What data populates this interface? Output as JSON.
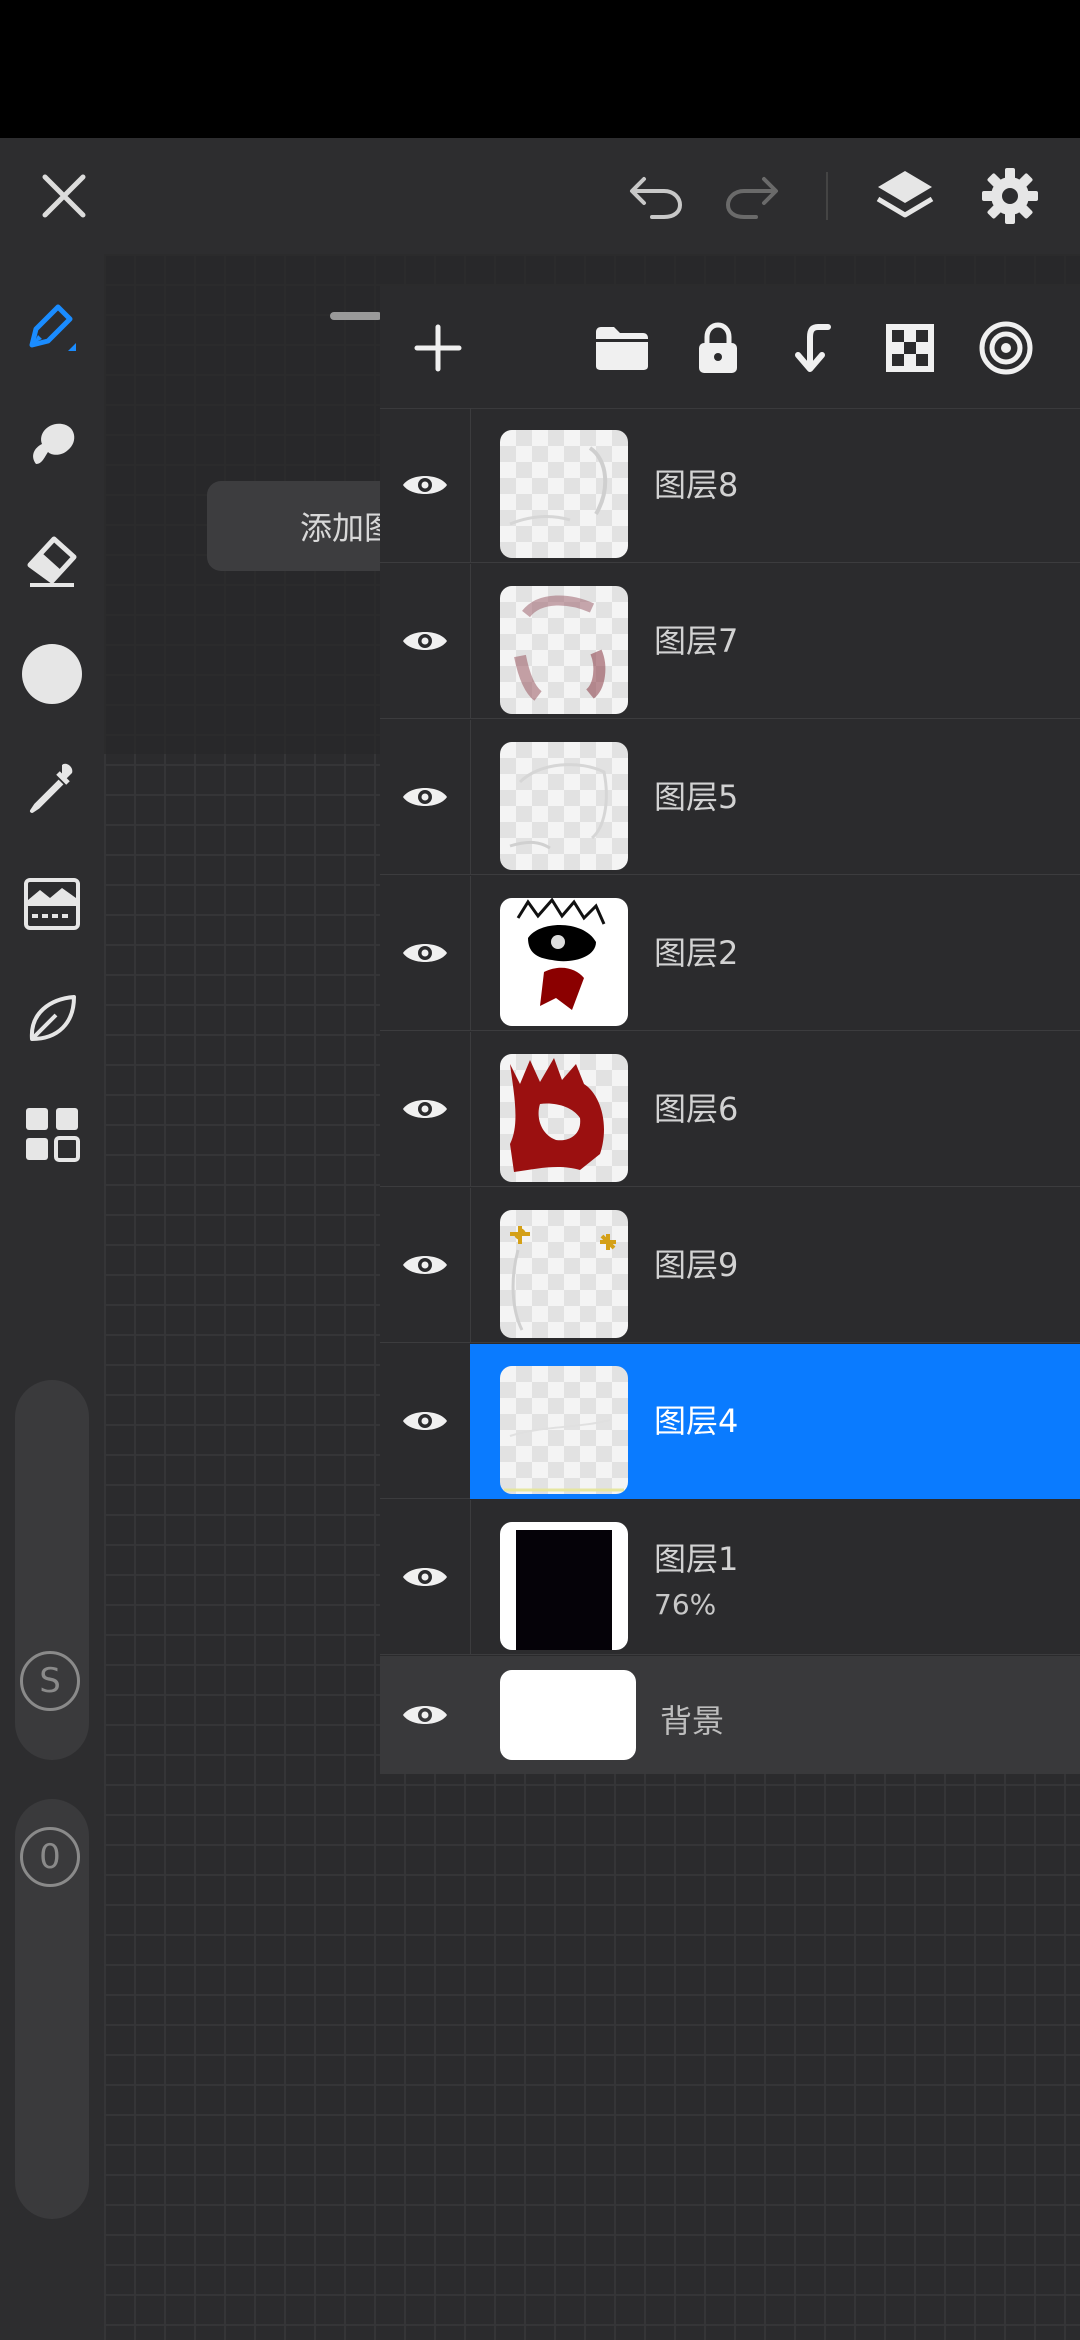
{
  "top_bar": {
    "close_icon": "close-icon",
    "undo_icon": "undo-icon",
    "redo_icon": "redo-icon",
    "layers_icon": "layers-icon",
    "settings_icon": "gear-icon"
  },
  "left_toolbar": {
    "tools": [
      "pen-icon",
      "smudge-icon",
      "eraser-icon",
      "color-dot-icon",
      "eyedropper-icon",
      "adjust-icon",
      "leaf-icon",
      "grid-icon"
    ],
    "size_button": "S",
    "opacity_button": "0",
    "active_color": "#1a8cff"
  },
  "canvas": {
    "hint_text": "添加图层"
  },
  "layers_panel": {
    "toolbar": [
      "add-icon",
      "folder-icon",
      "lock-icon",
      "merge-down-icon",
      "checker-icon",
      "target-icon"
    ],
    "layers": [
      {
        "name": "图层8",
        "opacity": "",
        "selected": false
      },
      {
        "name": "图层7",
        "opacity": "",
        "selected": false
      },
      {
        "name": "图层5",
        "opacity": "",
        "selected": false
      },
      {
        "name": "图层2",
        "opacity": "",
        "selected": false
      },
      {
        "name": "图层6",
        "opacity": "",
        "selected": false
      },
      {
        "name": "图层9",
        "opacity": "",
        "selected": false
      },
      {
        "name": "图层4",
        "opacity": "",
        "selected": true
      },
      {
        "name": "图层1",
        "opacity": "76%",
        "selected": false
      }
    ],
    "background": {
      "name": "背景"
    },
    "selected_color": "#0a7bff"
  }
}
